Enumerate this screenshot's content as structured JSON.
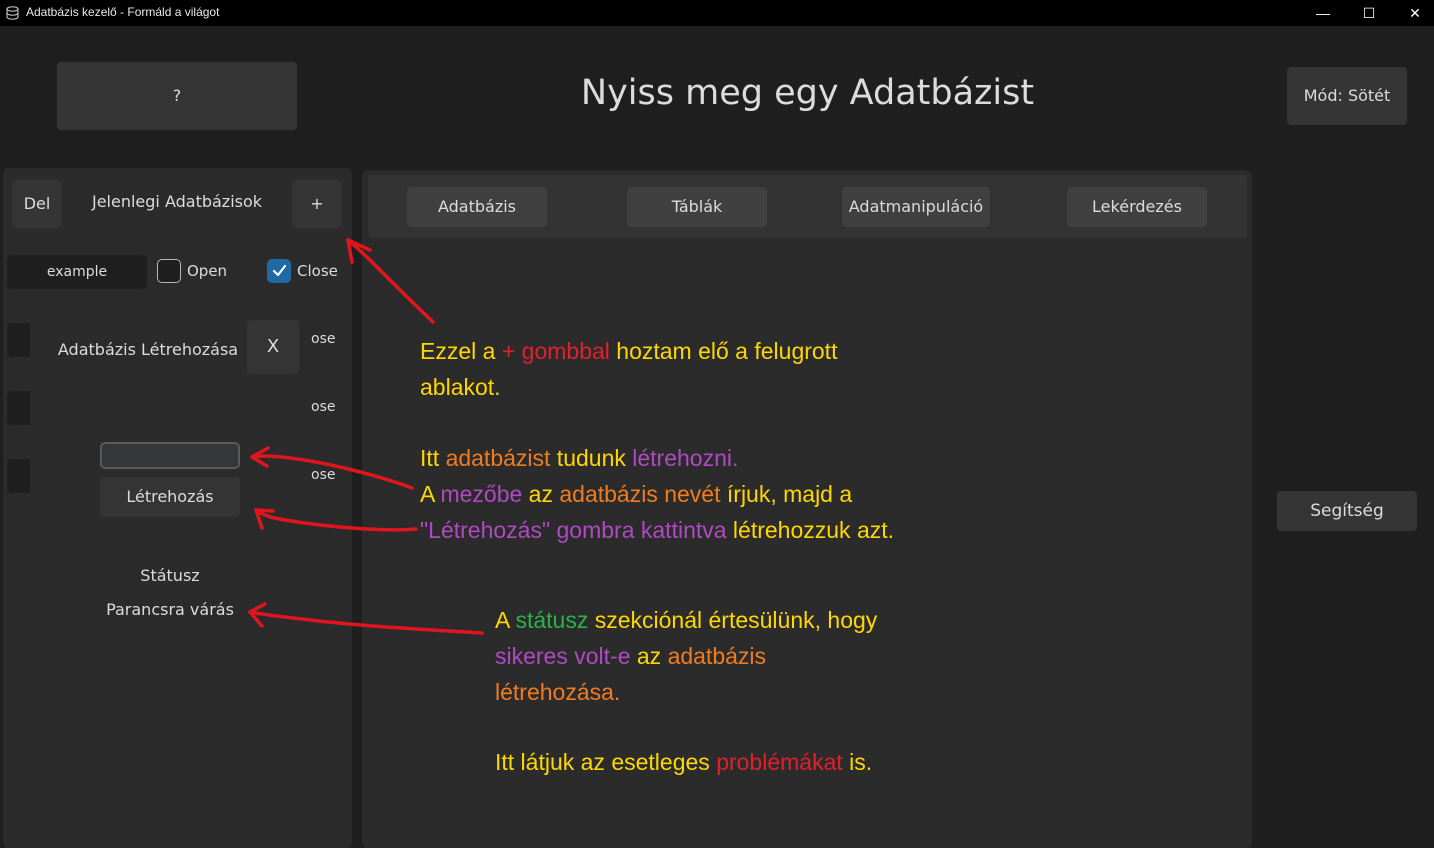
{
  "window": {
    "title": "Adatbázis kezelő - Formáld a világot",
    "minimize": "—",
    "maximize": "☐",
    "close": "✕"
  },
  "header": {
    "help_q": "?",
    "title": "Nyiss meg egy Adatbázist",
    "mode_button": "Mód: Sötét"
  },
  "sidebar": {
    "del_button": "Del",
    "title": "Jelenlegi Adatbázisok",
    "add_button": "+",
    "databases": [
      {
        "name": "example",
        "open_label": "Open",
        "open_checked": false,
        "close_label": "Close",
        "close_checked": true
      }
    ],
    "hidden_fragments": [
      "ose",
      "ose",
      "ose"
    ]
  },
  "popup": {
    "title": "Adatbázis Létrehozása",
    "close_button": "X",
    "input_value": "",
    "create_button": "Létrehozás",
    "status_label": "Státusz",
    "status_value": "Parancsra várás"
  },
  "tabs": [
    "Adatbázis",
    "Táblák",
    "Adatmanipuláció",
    "Lekérdezés"
  ],
  "help_button": "Segítség",
  "annotations": {
    "a1": [
      "Ezzel a ",
      "+ ",
      "gombbal",
      " hoztam elő a felugrott",
      "ablakot."
    ],
    "a2": [
      "Itt ",
      "adatbázist",
      " tudunk ",
      "létrehozni.",
      "A ",
      "mezőbe",
      " az ",
      "adatbázis nevét",
      " írjuk,",
      " majd a",
      "\"Létrehozás\" gombra kattintva",
      " létrehozzuk azt."
    ],
    "a3": [
      "A ",
      "státusz",
      " szekciónál értesülünk, hogy",
      "sikeres volt-e",
      " az ",
      "adatbázis",
      "létrehozása."
    ],
    "a4": [
      "Itt látjuk az esetleges ",
      "problémákat",
      " is."
    ]
  },
  "colors": {
    "background": "#1f1f1f",
    "panel": "#2b2b2b",
    "accent": "#1f6aa5",
    "annotation_yellow": "#ffd700",
    "annotation_red": "#e2202a",
    "annotation_orange": "#f07c20",
    "annotation_purple": "#b04ac2",
    "annotation_green": "#2bb24a"
  }
}
